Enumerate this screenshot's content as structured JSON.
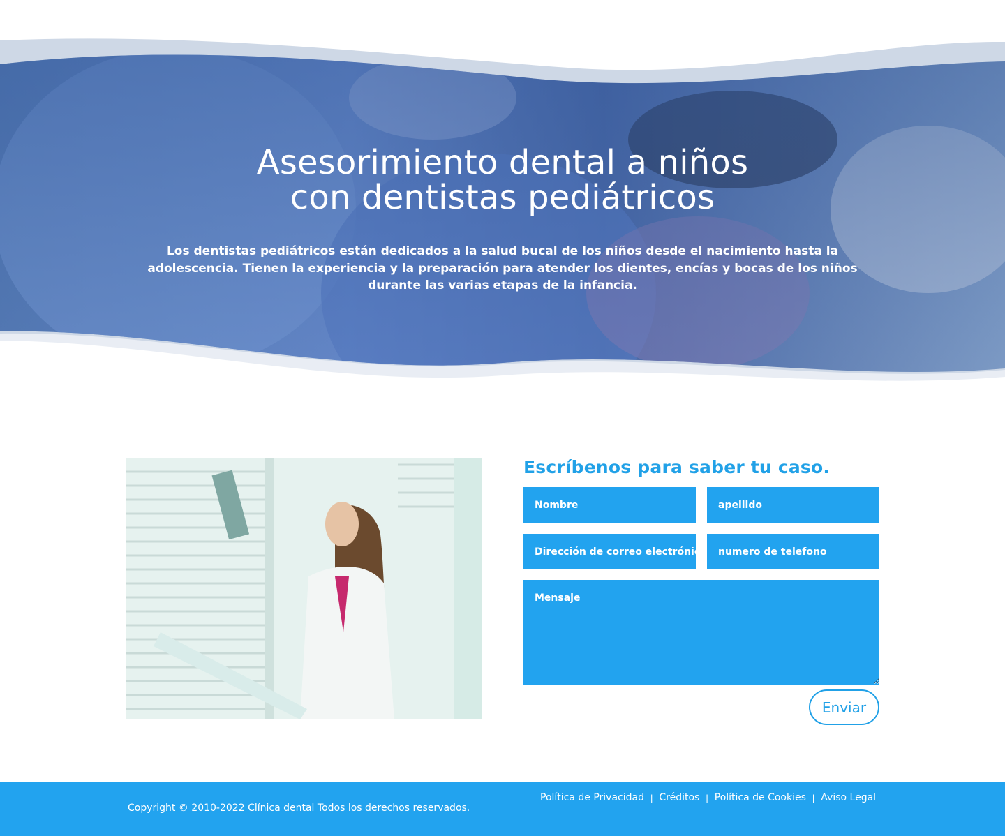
{
  "hero": {
    "title_line1": "Asesorimiento dental a niños",
    "title_line2": "con dentistas pediátricos",
    "description": "Los dentistas pediátricos están dedicados a la salud bucal de los niños desde el nacimiento hasta la adolescencia. Tienen la experiencia y la preparación para atender los dientes, encías y bocas de los niños durante las varias etapas de la infancia."
  },
  "form": {
    "title": "Escríbenos para saber tu caso.",
    "first_name_placeholder": "Nombre",
    "last_name_placeholder": "apellido",
    "email_placeholder": "Dirección de correo electrónico",
    "phone_placeholder": "numero de telefono",
    "message_placeholder": "Mensaje",
    "submit_label": "Enviar"
  },
  "footer": {
    "copyright": "Copyright © 2010-2022 Clínica dental Todos los derechos reservados.",
    "links": [
      {
        "label": "Política de Privacidad"
      },
      {
        "label": "Créditos"
      },
      {
        "label": "Política de Cookies"
      },
      {
        "label": "Aviso Legal"
      }
    ],
    "separator": "|"
  },
  "colors": {
    "accent": "#22a3ef",
    "title_blue": "#21a1e7",
    "hero_overlay": "#3a63a8"
  }
}
